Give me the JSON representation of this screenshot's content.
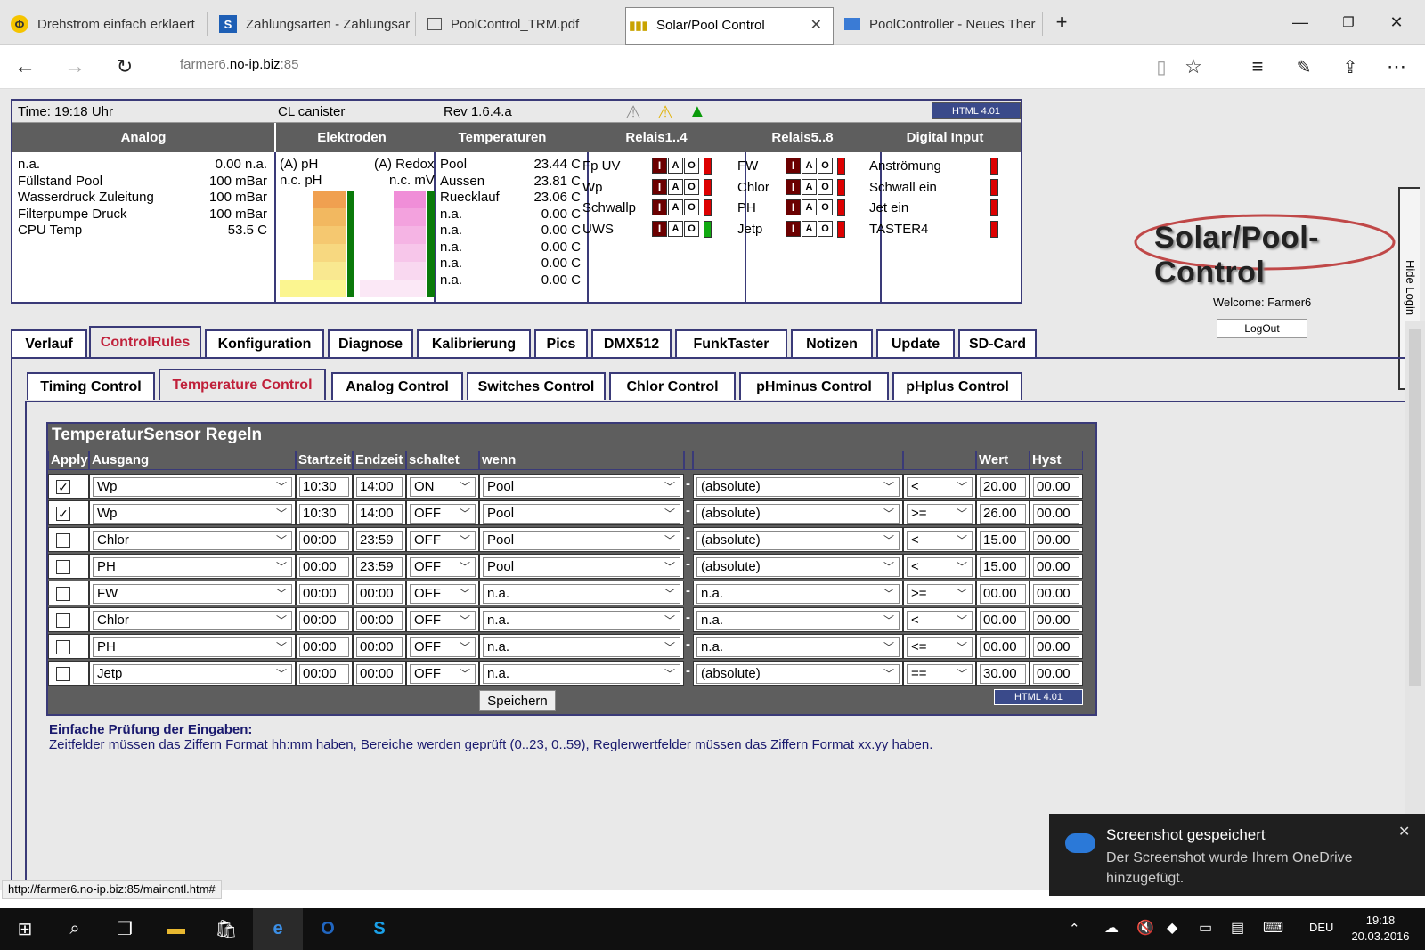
{
  "browser": {
    "tabs": [
      {
        "label": "Drehstrom einfach erklaert",
        "icon": "phi-icon"
      },
      {
        "label": "Zahlungsarten - Zahlungsar",
        "icon": "s-icon"
      },
      {
        "label": "PoolControl_TRM.pdf",
        "icon": "pdf-icon"
      },
      {
        "label": "Solar/Pool Control",
        "icon": "signal-icon"
      },
      {
        "label": "PoolController - Neues Ther",
        "icon": "forum-icon"
      }
    ],
    "url_prefix": "farmer6.",
    "url_host": "no-ip.biz",
    "url_suffix": ":85"
  },
  "status": {
    "time": "Time: 19:18 Uhr",
    "canister": "CL canister",
    "rev": "Rev 1.6.4.a",
    "html_badge": "HTML 4.01",
    "sections": [
      "Analog",
      "Elektroden",
      "Temperaturen",
      "Relais1..4",
      "Relais5..8",
      "Digital Input"
    ],
    "analog": [
      {
        "name": "n.a.",
        "value": "0.00 n.a."
      },
      {
        "name": "Füllstand Pool",
        "value": "100 mBar"
      },
      {
        "name": "Wasserdruck Zuleitung",
        "value": "100 mBar"
      },
      {
        "name": "Filterpumpe Druck",
        "value": "100 mBar"
      },
      {
        "name": "CPU Temp",
        "value": "53.5 C"
      }
    ],
    "electrodes": {
      "ph_label": "(A) pH",
      "ph_sub": "n.c. pH",
      "redox_label": "(A) Redox",
      "redox_sub": "n.c. mV"
    },
    "temps": [
      {
        "name": "Pool",
        "value": "23.44 C"
      },
      {
        "name": "Aussen",
        "value": "23.81 C"
      },
      {
        "name": "Ruecklauf",
        "value": "23.06 C"
      },
      {
        "name": "n.a.",
        "value": "0.00 C"
      },
      {
        "name": "n.a.",
        "value": "0.00 C"
      },
      {
        "name": "n.a.",
        "value": "0.00 C"
      },
      {
        "name": "n.a.",
        "value": "0.00 C"
      },
      {
        "name": "n.a.",
        "value": "0.00 C"
      }
    ],
    "relais1": [
      {
        "name": "Fp UV",
        "state": "red"
      },
      {
        "name": "Wp",
        "state": "red"
      },
      {
        "name": "Schwallp",
        "state": "red"
      },
      {
        "name": "UWS",
        "state": "green"
      }
    ],
    "relais2": [
      {
        "name": "FW",
        "state": "red"
      },
      {
        "name": "Chlor",
        "state": "red"
      },
      {
        "name": "PH",
        "state": "red"
      },
      {
        "name": "Jetp",
        "state": "red"
      }
    ],
    "relay_buttons": [
      "I",
      "A",
      "O"
    ],
    "digital": [
      "Anströmung",
      "Schwall ein",
      "Jet ein",
      "TASTER4"
    ]
  },
  "login": {
    "logo": "Solar/Pool-Control",
    "welcome": "Welcome:  Farmer6",
    "logout": "LogOut",
    "hide": "Hide Login"
  },
  "main_tabs": [
    "Verlauf",
    "ControlRules",
    "Konfiguration",
    "Diagnose",
    "Kalibrierung",
    "Pics",
    "DMX512",
    "FunkTaster",
    "Notizen",
    "Update",
    "SD-Card"
  ],
  "sub_tabs": [
    "Timing Control",
    "Temperature Control",
    "Analog Control",
    "Switches Control",
    "Chlor Control",
    "pHminus Control",
    "pHplus Control"
  ],
  "rules": {
    "title": "TemperaturSensor Regeln",
    "headers": [
      "Apply",
      "Ausgang",
      "Startzeit",
      "Endzeit",
      "schaltet",
      "wenn",
      "",
      "",
      "Wert",
      "Hyst"
    ],
    "rows": [
      {
        "apply": "✓",
        "out": "Wp",
        "start": "10:30",
        "end": "14:00",
        "sw": "ON",
        "when": "Pool",
        "mode": "(absolute)",
        "op": "<",
        "val": "20.00",
        "hyst": "00.00"
      },
      {
        "apply": "✓",
        "out": "Wp",
        "start": "10:30",
        "end": "14:00",
        "sw": "OFF",
        "when": "Pool",
        "mode": "(absolute)",
        "op": ">=",
        "val": "26.00",
        "hyst": "00.00"
      },
      {
        "apply": "",
        "out": "Chlor",
        "start": "00:00",
        "end": "23:59",
        "sw": "OFF",
        "when": "Pool",
        "mode": "(absolute)",
        "op": "<",
        "val": "15.00",
        "hyst": "00.00"
      },
      {
        "apply": "",
        "out": "PH",
        "start": "00:00",
        "end": "23:59",
        "sw": "OFF",
        "when": "Pool",
        "mode": "(absolute)",
        "op": "<",
        "val": "15.00",
        "hyst": "00.00"
      },
      {
        "apply": "",
        "out": "FW",
        "start": "00:00",
        "end": "00:00",
        "sw": "OFF",
        "when": "n.a.",
        "mode": "n.a.",
        "op": ">=",
        "val": "00.00",
        "hyst": "00.00"
      },
      {
        "apply": "",
        "out": "Chlor",
        "start": "00:00",
        "end": "00:00",
        "sw": "OFF",
        "when": "n.a.",
        "mode": "n.a.",
        "op": "<",
        "val": "00.00",
        "hyst": "00.00"
      },
      {
        "apply": "",
        "out": "PH",
        "start": "00:00",
        "end": "00:00",
        "sw": "OFF",
        "when": "n.a.",
        "mode": "n.a.",
        "op": "<=",
        "val": "00.00",
        "hyst": "00.00"
      },
      {
        "apply": "",
        "out": "Jetp",
        "start": "00:00",
        "end": "00:00",
        "sw": "OFF",
        "when": "n.a.",
        "mode": "(absolute)",
        "op": "==",
        "val": "30.00",
        "hyst": "00.00"
      }
    ],
    "save": "Speichern",
    "note_title": "Einfache Prüfung der Eingaben:",
    "note_text": "Zeitfelder müssen das Ziffern Format hh:mm haben, Bereiche werden geprüft (0..23, 0..59), Reglerwertfelder müssen das Ziffern Format xx.yy haben."
  },
  "status_url": "http://farmer6.no-ip.biz:85/maincntl.htm#",
  "toast": {
    "title": "Screenshot gespeichert",
    "body": "Der Screenshot wurde Ihrem OneDrive hinzugefügt."
  },
  "taskbar": {
    "lang": "DEU",
    "time": "19:18",
    "date": "20.03.2016"
  }
}
